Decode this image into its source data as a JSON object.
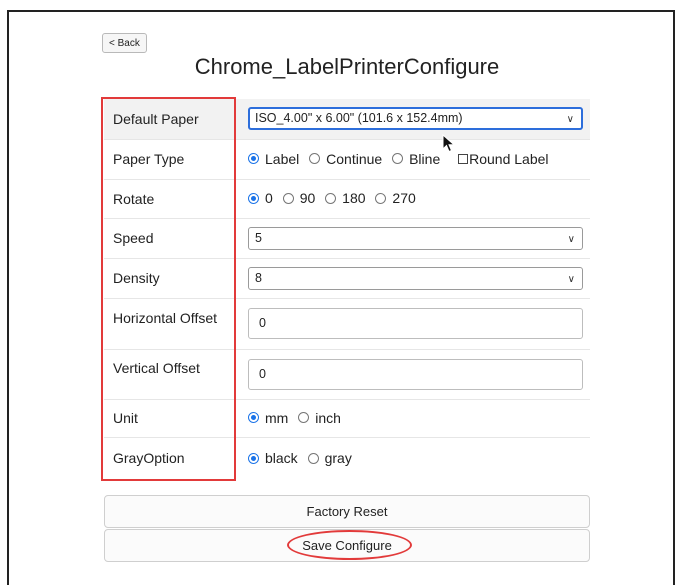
{
  "back_label": "< Back",
  "page_title": "Chrome_LabelPrinterConfigure",
  "rows": {
    "default_paper": {
      "label": "Default Paper",
      "value": "ISO_4.00\" x 6.00\" (101.6 x 152.4mm)"
    },
    "paper_type": {
      "label": "Paper Type",
      "options": [
        "Label",
        "Continue",
        "Bline"
      ],
      "selected": "Label",
      "checkbox_label": "Round Label",
      "checkbox_checked": false
    },
    "rotate": {
      "label": "Rotate",
      "options": [
        "0",
        "90",
        "180",
        "270"
      ],
      "selected": "0"
    },
    "speed": {
      "label": "Speed",
      "value": "5"
    },
    "density": {
      "label": "Density",
      "value": "8"
    },
    "horizontal_offset": {
      "label": "Horizontal Offset",
      "value": "0"
    },
    "vertical_offset": {
      "label": "Vertical Offset",
      "value": "0"
    },
    "unit": {
      "label": "Unit",
      "options": [
        "mm",
        "inch"
      ],
      "selected": "mm"
    },
    "gray_option": {
      "label": "GrayOption",
      "options": [
        "black",
        "gray"
      ],
      "selected": "black"
    }
  },
  "factory_reset_label": "Factory Reset",
  "save_label": "Save Configure",
  "colors": {
    "highlight_red": "#e23a3a",
    "radio_blue": "#1a73e8",
    "focus_blue": "#2d6edb"
  }
}
